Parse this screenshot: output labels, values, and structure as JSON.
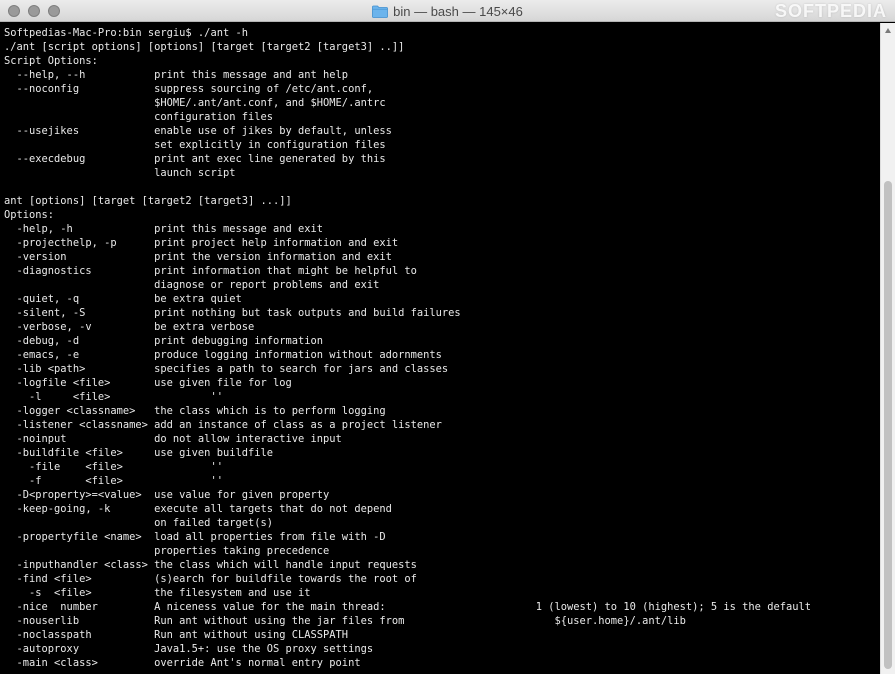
{
  "window": {
    "title": "bin — bash — 145×46",
    "watermark": "SOFTPEDIA"
  },
  "terminal": {
    "lines": [
      "Softpedias-Mac-Pro:bin sergiu$ ./ant -h",
      "./ant [script options] [options] [target [target2 [target3] ..]]",
      "Script Options:",
      "  --help, --h           print this message and ant help",
      "  --noconfig            suppress sourcing of /etc/ant.conf,",
      "                        $HOME/.ant/ant.conf, and $HOME/.antrc",
      "                        configuration files",
      "  --usejikes            enable use of jikes by default, unless",
      "                        set explicitly in configuration files",
      "  --execdebug           print ant exec line generated by this",
      "                        launch script",
      "",
      "ant [options] [target [target2 [target3] ...]]",
      "Options:",
      "  -help, -h             print this message and exit",
      "  -projecthelp, -p      print project help information and exit",
      "  -version              print the version information and exit",
      "  -diagnostics          print information that might be helpful to",
      "                        diagnose or report problems and exit",
      "  -quiet, -q            be extra quiet",
      "  -silent, -S           print nothing but task outputs and build failures",
      "  -verbose, -v          be extra verbose",
      "  -debug, -d            print debugging information",
      "  -emacs, -e            produce logging information without adornments",
      "  -lib <path>           specifies a path to search for jars and classes",
      "  -logfile <file>       use given file for log",
      "    -l     <file>                ''",
      "  -logger <classname>   the class which is to perform logging",
      "  -listener <classname> add an instance of class as a project listener",
      "  -noinput              do not allow interactive input",
      "  -buildfile <file>     use given buildfile",
      "    -file    <file>              ''",
      "    -f       <file>              ''",
      "  -D<property>=<value>  use value for given property",
      "  -keep-going, -k       execute all targets that do not depend",
      "                        on failed target(s)",
      "  -propertyfile <name>  load all properties from file with -D",
      "                        properties taking precedence",
      "  -inputhandler <class> the class which will handle input requests",
      "  -find <file>          (s)earch for buildfile towards the root of",
      "    -s  <file>          the filesystem and use it",
      "  -nice  number         A niceness value for the main thread:                        1 (lowest) to 10 (highest); 5 is the default",
      "  -nouserlib            Run ant without using the jar files from                        ${user.home}/.ant/lib",
      "  -noclasspath          Run ant without using CLASSPATH",
      "  -autoproxy            Java1.5+: use the OS proxy settings",
      "  -main <class>         override Ant's normal entry point"
    ]
  },
  "colors": {
    "background": "#000000",
    "text": "#eaeaea",
    "titlebar": "#e0e0e0",
    "folder": "#5aa9e6"
  },
  "icons": [
    "close-button-icon",
    "minimize-button-icon",
    "zoom-button-icon",
    "folder-icon",
    "scroll-up-arrow-icon"
  ]
}
